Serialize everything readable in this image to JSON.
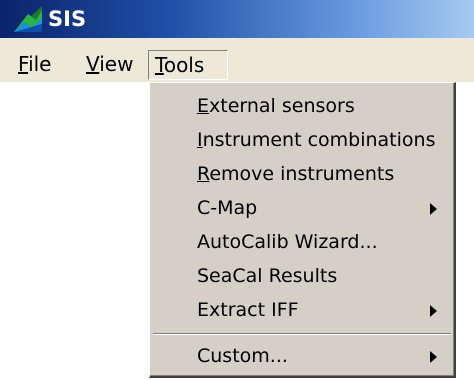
{
  "window": {
    "title": "SIS"
  },
  "menubar": [
    {
      "pre": "",
      "key": "F",
      "post": "ile"
    },
    {
      "pre": "",
      "key": "V",
      "post": "iew"
    },
    {
      "pre": "",
      "key": "T",
      "post": "ools"
    }
  ],
  "tools_menu": {
    "items": [
      {
        "pre": "",
        "key": "E",
        "post": "xternal sensors",
        "submenu": false
      },
      {
        "pre": "",
        "key": "I",
        "post": "nstrument combinations",
        "submenu": false
      },
      {
        "pre": "",
        "key": "R",
        "post": "emove instruments",
        "submenu": false
      },
      {
        "pre": "C-Map",
        "key": "",
        "post": "",
        "submenu": true
      },
      {
        "pre": "AutoCalib Wizard...",
        "key": "",
        "post": "",
        "submenu": false
      },
      {
        "pre": "SeaCal Results",
        "key": "",
        "post": "",
        "submenu": false
      },
      {
        "pre": "Extract IFF",
        "key": "",
        "post": "",
        "submenu": true
      },
      {
        "pre": "Custom...",
        "key": "",
        "post": "",
        "submenu": true
      }
    ]
  },
  "colors": {
    "menu_background": "#d4d0c8",
    "menubar_background": "#ece9d8",
    "titlebar_start": "#0a246a",
    "titlebar_end": "#a6caf0"
  }
}
